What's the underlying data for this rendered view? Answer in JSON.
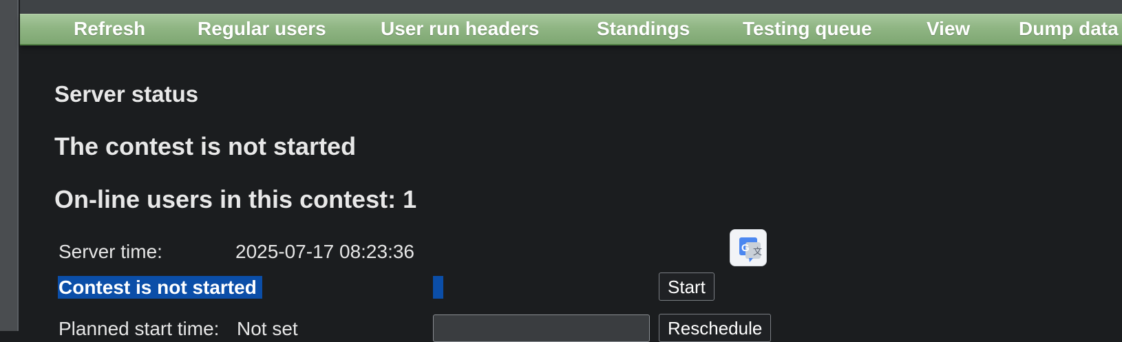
{
  "menu": {
    "items": [
      {
        "label": "Refresh"
      },
      {
        "label": "Regular users"
      },
      {
        "label": "User run headers"
      },
      {
        "label": "Standings"
      },
      {
        "label": "Testing queue"
      },
      {
        "label": "View"
      },
      {
        "label": "Dump data"
      }
    ]
  },
  "page": {
    "server_status_title": "Server status",
    "contest_state_heading": "The contest is not started",
    "online_users_heading": "On-line users in this contest: 1"
  },
  "status_table": {
    "server_time_label": "Server time:",
    "server_time_value": "2025-07-17 08:23:36",
    "contest_status_text": "Contest is not started",
    "start_button_label": "Start",
    "planned_start_label": "Planned start time:",
    "planned_start_value": "Not set",
    "reschedule_input_value": "",
    "reschedule_button_label": "Reschedule"
  },
  "icons": {
    "translate": "google-translate-icon"
  },
  "colors": {
    "menu_green": "#8fb583",
    "selection_blue": "#0b4ea8",
    "background": "#1b1d1f"
  }
}
